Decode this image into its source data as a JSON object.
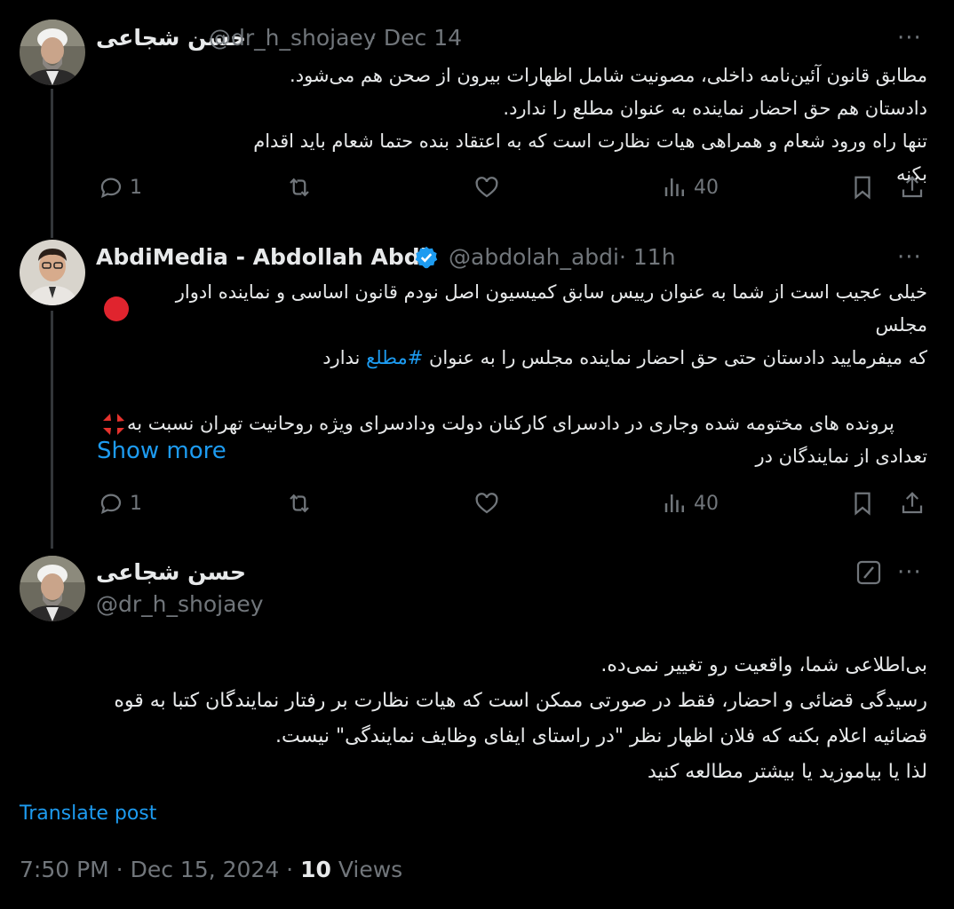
{
  "tweet1": {
    "display_name": "حسن شجاعی",
    "handle": "@dr_h_shojaey",
    "date": "· Dec 14",
    "more": "···",
    "lines": [
      "مطابق قانون آئین‌نامه داخلی، مصونیت شامل اظهارات بیرون از صحن هم می‌شود.",
      "دادستان هم حق احضار نماینده به عنوان مطلع را ندارد.",
      "تنها راه ورود شعام و همراهی هیات نظارت است که به اعتقاد بنده حتما شعام باید اقدام بکنه"
    ],
    "replies": "1",
    "views": "40"
  },
  "tweet2": {
    "display_name": "AbdiMedia - Abdollah Abdi",
    "handle": "@abdolah_abdi",
    "date": "· 11h",
    "more": "···",
    "line1": "خیلی عجیب است از شما به عنوان رییس سابق کمیسیون اصل نودم قانون اساسی و نماینده ادوار مجلس",
    "line2_pre": "که میفرمایید دادستان حتی حق احضار نماینده مجلس را به عنوان",
    "hashtag": "#مطلع",
    "line2_post": "ندارد",
    "line3": "پرونده های مختومه شده وجاری در دادسرای کارکنان دولت ودادسرای ویژه روحانیت تهران نسبت به",
    "line4": "تعدادی از نمایندگان در",
    "show_more": "Show more",
    "replies": "1",
    "views": "40"
  },
  "main_tweet": {
    "display_name": "حسن شجاعی",
    "handle": "@dr_h_shojaey",
    "more": "···",
    "lines": [
      "بی‌اطلاعی شما، واقعیت رو تغییر نمی‌ده.",
      "رسیدگی قضائی و احضار، فقط در صورتی ممکن است که هیات نظارت بر رفتار نمایندگان کتبا به قوه",
      "قضائیه اعلام بکنه که فلان اظهار نظر \"در راستای ایفای وظایف نمایندگی\" نیست.",
      "لذا یا بیاموزید یا بیشتر مطالعه کنید"
    ],
    "translate": "Translate post",
    "time": "7:50 PM · Dec 15, 2024 ·",
    "views_count": "10",
    "views_label": "Views"
  },
  "colors": {
    "accent": "#1d9bf0",
    "muted": "#71767b",
    "text": "#e7e9ea",
    "background": "#000000"
  },
  "icons": [
    "reply-icon",
    "retweet-icon",
    "like-icon",
    "views-icon",
    "bookmark-icon",
    "share-icon",
    "verified-badge-icon",
    "edit-grok-icon"
  ]
}
